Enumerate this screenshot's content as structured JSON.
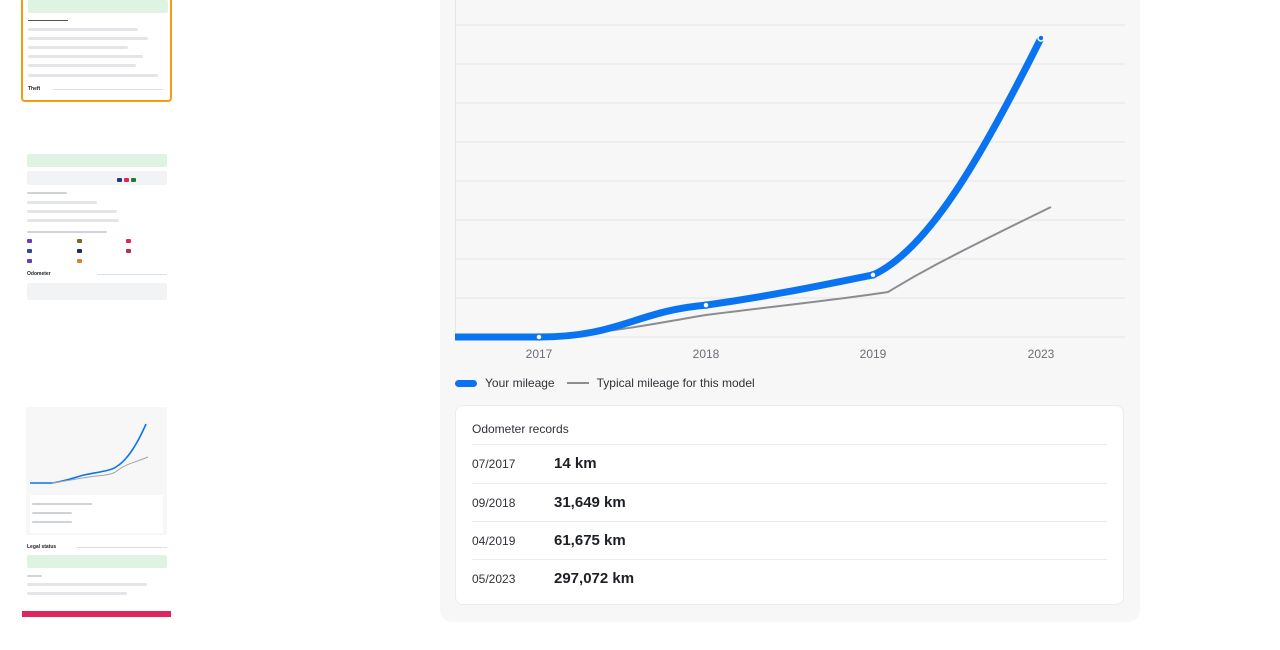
{
  "chart": {
    "ticks": [
      "2017",
      "2018",
      "2019",
      "2023"
    ],
    "legend": {
      "your_mileage": "Your mileage",
      "typical": "Typical mileage for this model"
    },
    "colors": {
      "yours": "#0a74f0",
      "typical": "#8a8d92",
      "grid": "#e6e6e6"
    }
  },
  "chart_data": {
    "type": "line",
    "x": [
      "2017",
      "2018",
      "2019",
      "2023"
    ],
    "series": [
      {
        "name": "Your mileage",
        "values": [
          14,
          31649,
          61675,
          297072
        ]
      },
      {
        "name": "Typical mileage for this model",
        "values": [
          0,
          20000,
          42000,
          130000
        ]
      }
    ],
    "legend_position": "bottom-left",
    "grid": true
  },
  "records": {
    "header": "Odometer records",
    "rows": [
      {
        "date": "07/2017",
        "value": "14 km"
      },
      {
        "date": "09/2018",
        "value": "31,649 km"
      },
      {
        "date": "04/2019",
        "value": "61,675 km"
      },
      {
        "date": "05/2023",
        "value": "297,072 km"
      }
    ]
  },
  "thumbnails": {
    "theft_title": "Theft",
    "odometer_title": "Odometer",
    "legal_title": "Legal status"
  }
}
